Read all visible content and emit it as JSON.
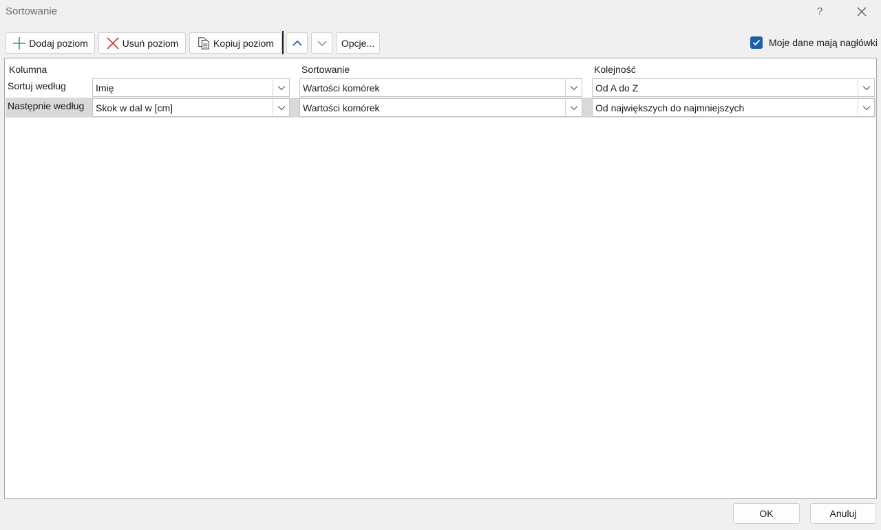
{
  "window": {
    "title": "Sortowanie",
    "help_label": "?"
  },
  "toolbar": {
    "add_level": "Dodaj poziom",
    "delete_level": "Usuń poziom",
    "copy_level": "Kopiuj poziom",
    "options": "Opcje...",
    "headers_checkbox_label": "Moje dane mają nagłówki",
    "headers_checkbox_checked": true
  },
  "grid": {
    "headers": {
      "column": "Kolumna",
      "sort_on": "Sortowanie",
      "order": "Kolejność"
    },
    "rows": [
      {
        "label": "Sortuj według",
        "column": "Imię",
        "sort_on": "Wartości komórek",
        "order": "Od A do Z",
        "selected": false
      },
      {
        "label": "Następnie według",
        "column": "Skok w dal w [cm]",
        "sort_on": "Wartości komórek",
        "order": "Od największych do najmniejszych",
        "selected": true
      }
    ]
  },
  "footer": {
    "ok": "OK",
    "cancel": "Anuluj"
  },
  "colors": {
    "accent": "#1f5fa8",
    "add_icon": "#2e9e4f",
    "delete_icon": "#d13438",
    "selected_row": "#d9d9d9"
  },
  "icons": [
    "plus-icon",
    "x-icon",
    "copy-icon",
    "chevron-up-icon",
    "chevron-down-icon",
    "checkmark-icon",
    "close-icon",
    "dropdown-arrow-icon"
  ]
}
